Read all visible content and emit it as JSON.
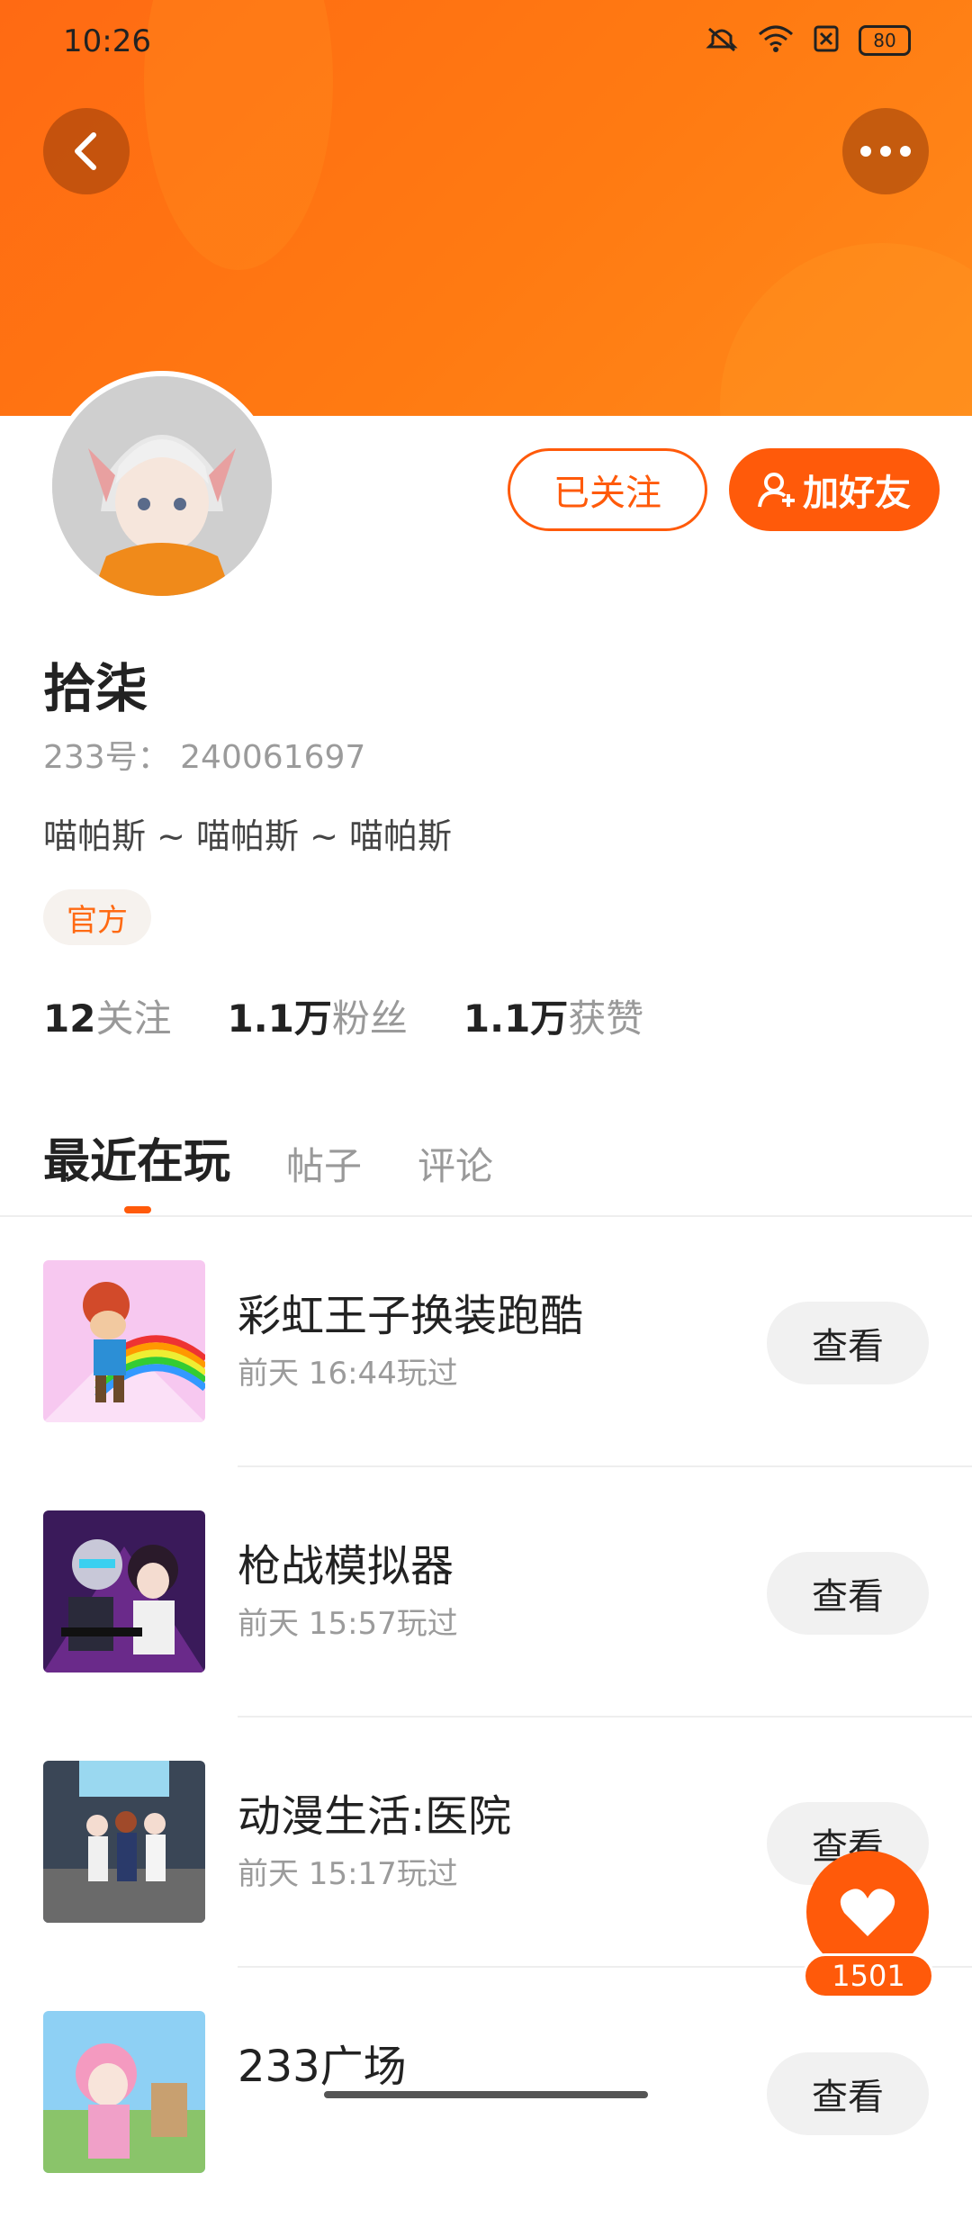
{
  "status_bar": {
    "time": "10:26",
    "battery": "80"
  },
  "profile": {
    "name": "拾柒",
    "uid": "233号：  240061697",
    "bio": "喵帕斯 ~ 喵帕斯 ~ 喵帕斯",
    "badge": "官方",
    "following_label": "已关注",
    "add_friend_label": "加好友"
  },
  "stats": [
    {
      "value": "12",
      "label": "关注"
    },
    {
      "value": "1.1万",
      "label": "粉丝"
    },
    {
      "value": "1.1万",
      "label": "获赞"
    }
  ],
  "tabs": [
    "最近在玩",
    "帖子",
    "评论"
  ],
  "games": [
    {
      "title": "彩虹王子换装跑酷",
      "played": "前天 16:44玩过",
      "action": "查看"
    },
    {
      "title": "枪战模拟器",
      "played": "前天 15:57玩过",
      "action": "查看"
    },
    {
      "title": "动漫生活:医院",
      "played": "前天 15:17玩过",
      "action": "查看"
    },
    {
      "title": "233广场",
      "played": "",
      "action": "查看"
    }
  ],
  "likes": {
    "count": "1501"
  },
  "colors": {
    "accent": "#ff5a0a",
    "hero": "#ff7a12"
  }
}
